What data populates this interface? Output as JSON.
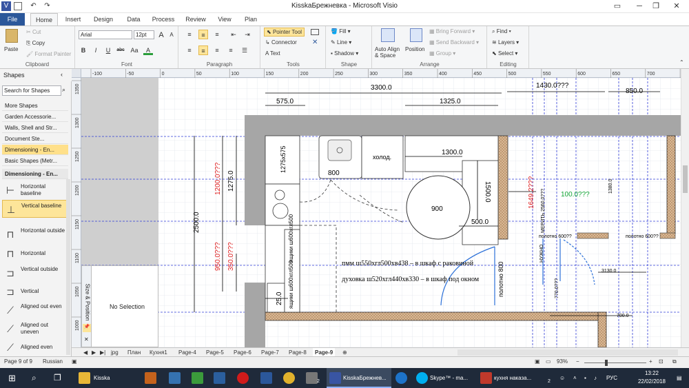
{
  "titlebar": {
    "title": "KisskaБрежневка - Microsoft Visio",
    "app_letter": "V",
    "undo_glyph": "↶",
    "redo_glyph": "↷",
    "minimize": "─",
    "restore": "❐",
    "close": "✕"
  },
  "tabs": [
    "File",
    "Home",
    "Insert",
    "Design",
    "Data",
    "Process",
    "Review",
    "View",
    "Plan"
  ],
  "ribbon": {
    "clipboard": {
      "label": "Clipboard",
      "paste": "Paste",
      "cut": "Cut",
      "copy": "Copy",
      "format_painter": "Format Painter"
    },
    "font": {
      "label": "Font",
      "font_name": "Arial",
      "font_size": "12pt",
      "bold": "B",
      "italic": "I",
      "underline": "U",
      "strike": "abc",
      "case": "Aa",
      "color": "A",
      "grow": "A",
      "shrink": "A"
    },
    "paragraph": {
      "label": "Paragraph"
    },
    "tools": {
      "label": "Tools",
      "pointer": "Pointer Tool",
      "connector": "Connector",
      "text": "Text"
    },
    "shape": {
      "label": "Shape",
      "fill": "Fill",
      "line": "Line",
      "shadow": "Shadow"
    },
    "arrange": {
      "label": "Arrange",
      "auto_align": "Auto Align & Space",
      "position": "Position",
      "bring_forward": "Bring Forward",
      "send_backward": "Send Backward",
      "group": "Group"
    },
    "editing": {
      "label": "Editing",
      "find": "Find",
      "layers": "Layers",
      "select": "Select"
    }
  },
  "shapes_panel": {
    "title": "Shapes",
    "search_placeholder": "Search for Shapes",
    "more_shapes": "More Shapes",
    "stencils": [
      "Garden Accessorie...",
      "Walls, Shell and Str...",
      "Document Ste...",
      "Dimensioning - En...",
      "Basic Shapes (Metr..."
    ],
    "stencil_header": "Dimensioning - En...",
    "masters": [
      "Horizontal baseline",
      "Vertical baseline",
      "Horizontal outside",
      "Horizontal",
      "Vertical outside",
      "Vertical",
      "Aligned out even",
      "Aligned out uneven",
      "Aligned even"
    ]
  },
  "size_position": {
    "title": "Size & Position",
    "content": "No Selection"
  },
  "ruler_top": [
    "-100",
    "-50",
    "0",
    "50",
    "100",
    "150",
    "200",
    "250",
    "300",
    "350",
    "400",
    "450",
    "500",
    "550",
    "600",
    "650",
    "700",
    "750"
  ],
  "ruler_left": [
    "1350",
    "1300",
    "1250",
    "1200",
    "1150",
    "1100",
    "1050",
    "1000"
  ],
  "drawing": {
    "dims": [
      "3300.0",
      "575.0",
      "1325.0",
      "1430.0???",
      "850.0",
      "1300.0",
      "800",
      "900",
      "500.0",
      "1500.0",
      "1200.0???",
      "1275.0",
      "2500.0",
      "950.0???",
      "350.0???",
      "25.0",
      "1275x575",
      "холод.",
      "1649.2???",
      "МЕРИТЬ 2560.0???",
      "100.0???",
      "1380.0",
      "полотно 600??",
      "полотно 600??",
      "НУЖНО",
      "770.0???",
      "3130.0",
      "700.0",
      "полотно 800",
      "ящики ш600хгл500",
      "ящики ш600хгл500"
    ],
    "note1": "пмм ш550хгл500хв438 – в шкаф с раковиной",
    "note2": "духовка ш520хгл440хв330 – в шкаф под окном"
  },
  "sheet_tabs": [
    "jpg",
    "План",
    "Кухня1",
    "Page-4",
    "Page-5",
    "Page-6",
    "Page-7",
    "Page-8",
    "Page-9"
  ],
  "status": {
    "page": "Page 9 of 9",
    "language": "Russian",
    "zoom": "93%"
  },
  "taskbar": {
    "items": [
      "Kisska",
      "KisskaБрежнев...",
      "Skype™ - ma...",
      "кухня наказа..."
    ],
    "lang": "РУС",
    "time": "13:22",
    "date": "22/02/2018",
    "badge2": "2"
  }
}
